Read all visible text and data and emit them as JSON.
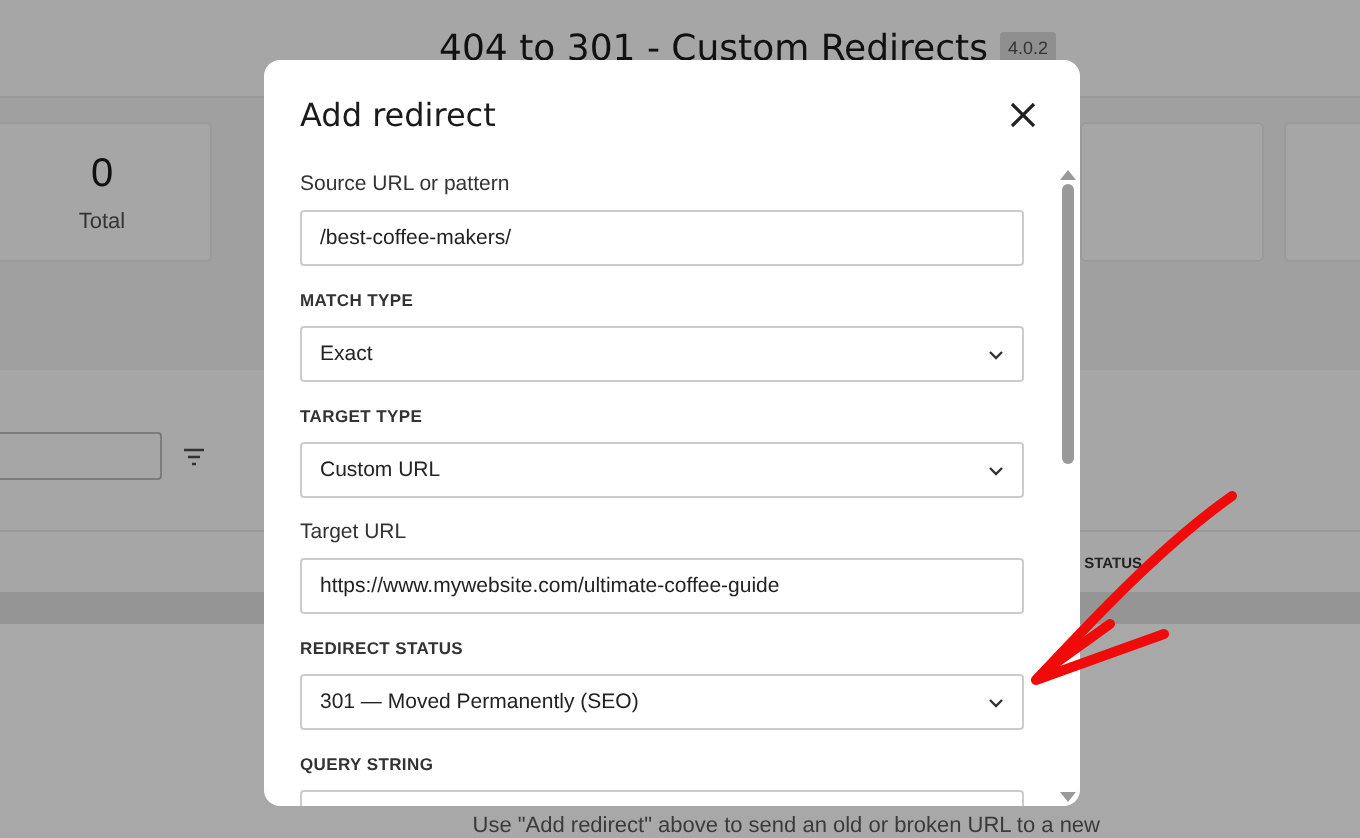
{
  "page": {
    "title": "404 to 301 - Custom Redirects",
    "version": "4.0.2"
  },
  "stats": [
    {
      "value": "0",
      "label": "Total"
    }
  ],
  "table": {
    "columns": [
      "STATUS"
    ]
  },
  "empty_hint": "Use \"Add redirect\" above to send an old or broken URL to a new",
  "modal": {
    "title": "Add redirect",
    "fields": [
      {
        "label": "Source URL or pattern",
        "label_heading": false,
        "kind": "text",
        "value": "/best-coffee-makers/"
      },
      {
        "label": "MATCH TYPE",
        "label_heading": true,
        "kind": "select",
        "value": "Exact"
      },
      {
        "label": "TARGET TYPE",
        "label_heading": true,
        "kind": "select",
        "value": "Custom URL"
      },
      {
        "label": "Target URL",
        "label_heading": false,
        "kind": "text",
        "value": "https://www.mywebsite.com/ultimate-coffee-guide"
      },
      {
        "label": "REDIRECT STATUS",
        "label_heading": true,
        "kind": "select",
        "value": "301 — Moved Permanently (SEO)"
      },
      {
        "label": "QUERY STRING",
        "label_heading": true,
        "kind": "text"
      }
    ]
  }
}
